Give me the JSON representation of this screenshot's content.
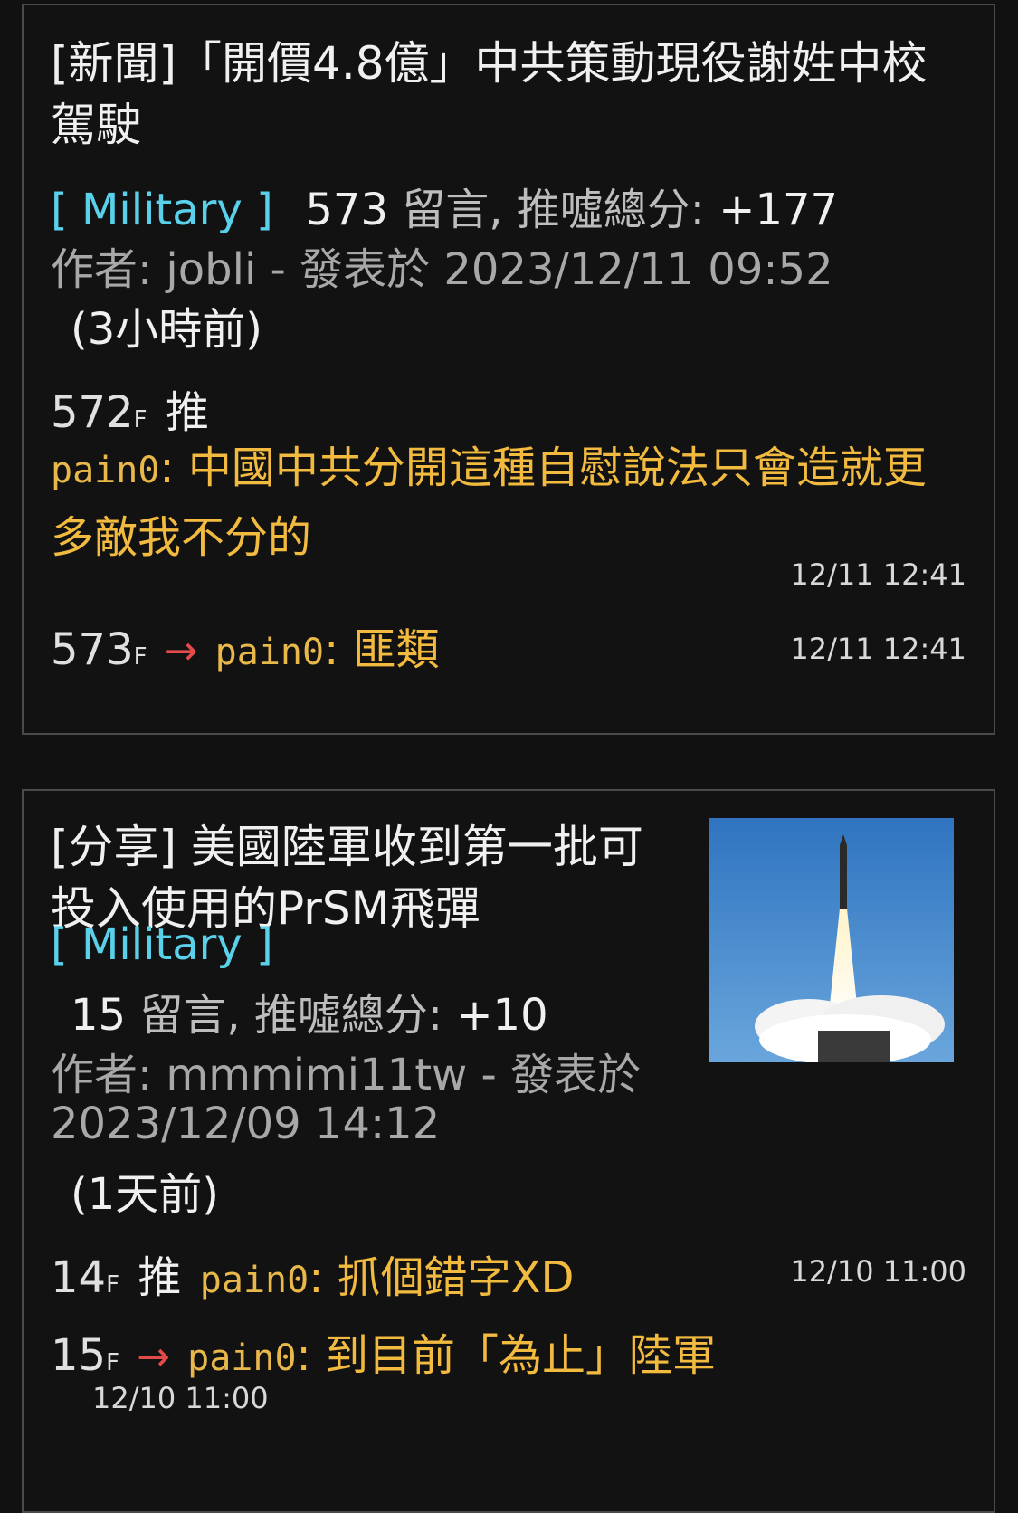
{
  "posts": [
    {
      "title": "[新聞]「開價4.8億」中共策動現役謝姓中校駕駛",
      "board": "[ Military ]",
      "comment_count": "573",
      "comment_label": "留言, 推噓總分:",
      "score": "+177",
      "author_line": "作者: jobli - 發表於 2023/12/11 09:52",
      "ago": "(3小時前)",
      "comments": [
        {
          "floor": "572",
          "floor_suffix": "F",
          "tag": "推",
          "user": "pain0",
          "text": "中國中共分開這種自慰說法只會造就更多敵我不分的",
          "time": "12/11 12:41"
        },
        {
          "floor": "573",
          "floor_suffix": "F",
          "tag": "→",
          "user": "pain0",
          "text": "匪類",
          "time": "12/11 12:41"
        }
      ]
    },
    {
      "title": "[分享] 美國陸軍收到第一批可投入使用的PrSM飛彈",
      "board": "[ Military ]",
      "comment_count": "15",
      "comment_label": "留言, 推噓總分:",
      "score": "+10",
      "author_line_1": "作者: mmmimi11tw - 發表於",
      "author_line_2": "2023/12/09 14:12",
      "ago": "(1天前)",
      "comments": [
        {
          "floor": "14",
          "floor_suffix": "F",
          "tag": "推",
          "user": "pain0",
          "text": "抓個錯字XD",
          "time": "12/10 11:00"
        },
        {
          "floor": "15",
          "floor_suffix": "F",
          "tag": "→",
          "user": "pain0",
          "text": "到目前「為止」陸軍",
          "time": "12/10 11:00"
        }
      ]
    }
  ],
  "colors": {
    "board": "#5ad1ea",
    "push_arrow": "#e34a4a",
    "comment": "#f2bb3f"
  }
}
